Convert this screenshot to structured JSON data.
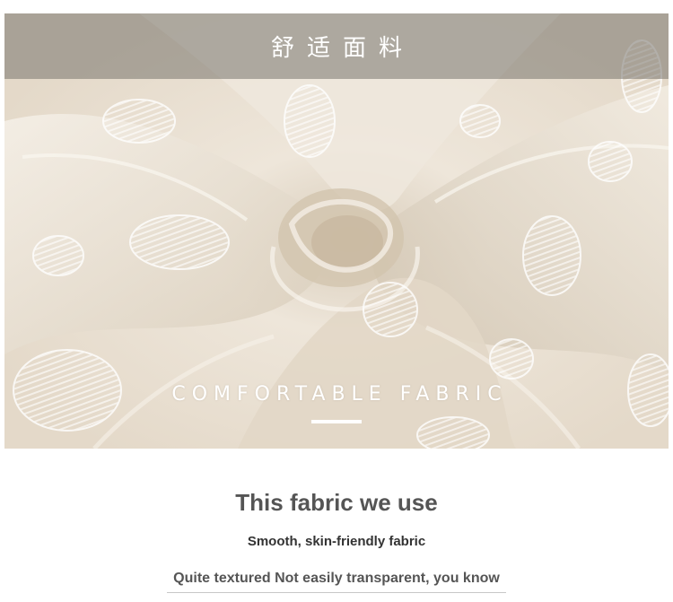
{
  "banner": {
    "title_cn": "舒适面料",
    "caption": "COMFORTABLE FABRIC",
    "band_color": "#78746e",
    "fabric_color": "#ece3d6"
  },
  "info": {
    "title": "This fabric we use",
    "subtitle": "Smooth, skin-friendly fabric",
    "note": "Quite textured Not easily transparent, you know"
  }
}
